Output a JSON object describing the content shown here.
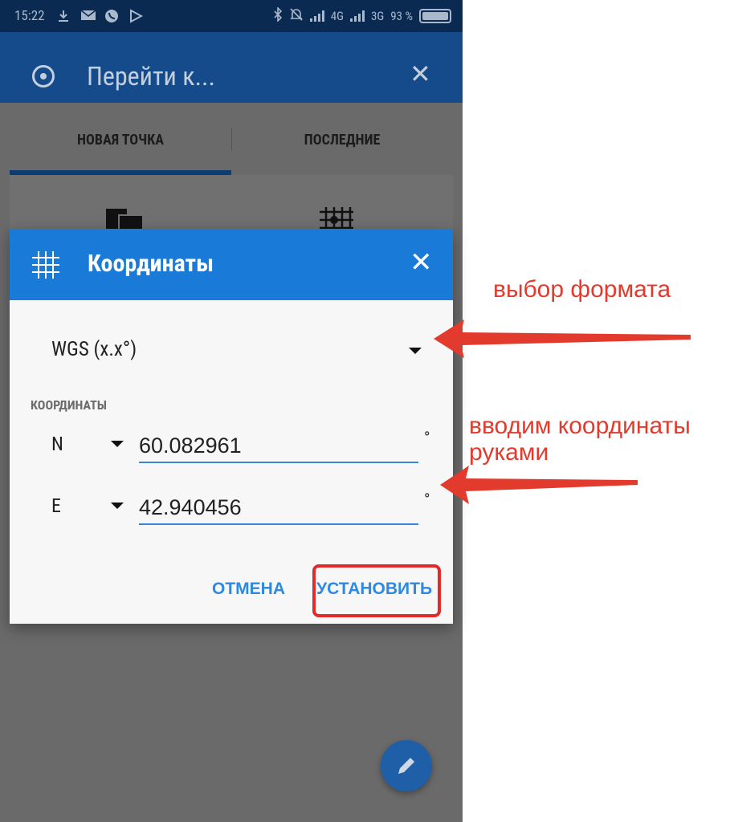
{
  "statusbar": {
    "time": "15:22",
    "network_1": "4G",
    "network_2": "3G",
    "battery": "93 %"
  },
  "appbar": {
    "title": "Перейти к..."
  },
  "tabs": [
    {
      "label": "НОВАЯ ТОЧКА",
      "active": true
    },
    {
      "label": "ПОСЛЕДНИЕ",
      "active": false
    }
  ],
  "dialog": {
    "title": "Координаты",
    "format": "WGS (x.x°)",
    "section_label": "КООРДИНАТЫ",
    "latitude": {
      "hemisphere": "N",
      "value": "60.082961",
      "unit": "°"
    },
    "longitude": {
      "hemisphere": "E",
      "value": "42.940456",
      "unit": "°"
    },
    "cancel_label": "ОТМЕНА",
    "set_label": "УСТАНОВИТЬ"
  },
  "annotations": {
    "format_choice": "выбор формата",
    "manual_entry_line1": "вводим координаты",
    "manual_entry_line2": "руками"
  },
  "colors": {
    "status_bar": "#0b2a52",
    "app_bar": "#154b8a",
    "dialog_header": "#1a7ad8",
    "accent": "#2d8ae3",
    "annotation": "#e23b2e"
  }
}
